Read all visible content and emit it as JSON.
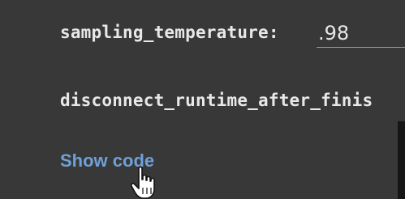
{
  "form": {
    "sampling_temperature": {
      "label": "sampling_temperature:",
      "value": ".98"
    },
    "disconnect_runtime": {
      "label": "disconnect_runtime_after_finis"
    },
    "show_code_link": "Show code"
  },
  "cursor": {
    "icon": "hand-pointer-icon"
  },
  "colors": {
    "background": "#383838",
    "label_text": "#e8e8e8",
    "link": "#6fa0d6"
  }
}
